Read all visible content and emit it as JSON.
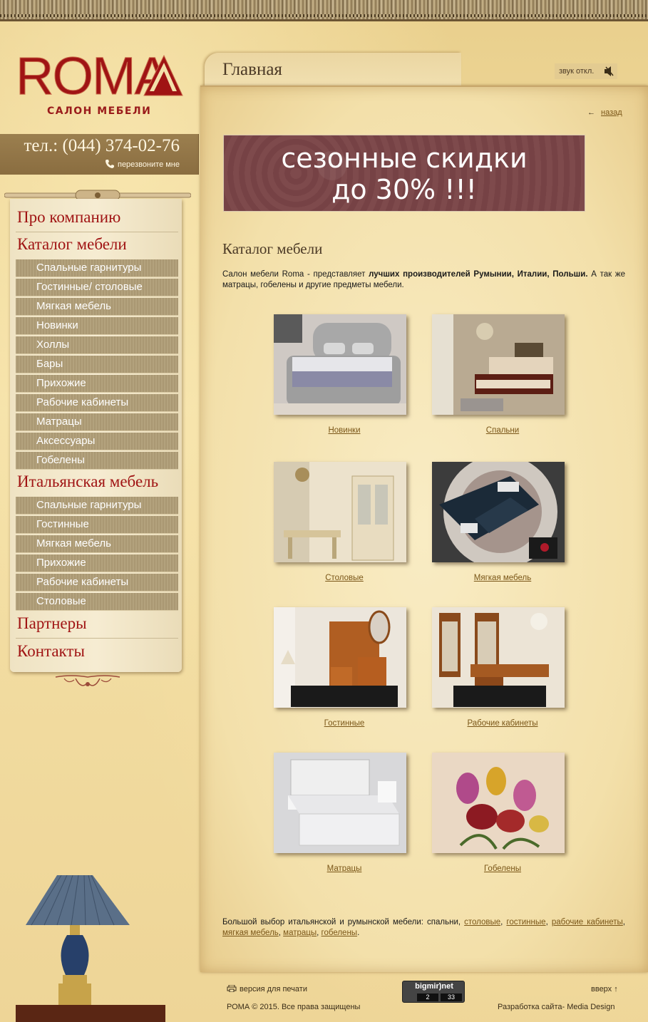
{
  "logo": {
    "name": "ROMA",
    "subtitle": "САЛОН МЕБЕЛИ"
  },
  "contact": {
    "phone": "тел.: (044) 374-02-76",
    "callback": "перезвоните мне"
  },
  "menu": {
    "about": "Про компанию",
    "catalog": "Каталог мебели",
    "catalog_items": [
      "Спальные гарнитуры",
      "Гостинные/ столовые",
      "Мягкая мебель",
      "Новинки",
      "Холлы",
      "Бары",
      "Прихожие",
      "Рабочие кабинеты",
      "Матрацы",
      "Аксессуары",
      "Гобелены"
    ],
    "italian": "Итальянская мебель",
    "italian_items": [
      "Спальные гарнитуры",
      "Гостинные",
      "Мягкая мебель",
      "Прихожие",
      "Рабочие кабинеты",
      "Столовые"
    ],
    "partners": "Партнеры",
    "contacts": "Контакты"
  },
  "header": {
    "title": "Главная",
    "sound": "звук откл."
  },
  "nav": {
    "back": "назад"
  },
  "banner": {
    "line1": "сезонные скидки",
    "line2": "до 30% !!!"
  },
  "main": {
    "section_title": "Каталог мебели",
    "intro_plain": "Салон мебели Roma - представляет ",
    "intro_bold": " лучших производителей Румынии, Италии, Польши.",
    "intro_tail": " А так же матрацы, гобелены и другие предметы мебели.",
    "tiles": [
      "Новинки",
      "Спальни",
      "Столовые",
      "Мягкая мебель",
      "Гостинные",
      "Рабочие кабинеты",
      "Матрацы",
      "Гобелены"
    ],
    "bottom_lead": "Большой выбор итальянской и румынской мебели: спальни, ",
    "bottom_links": [
      "столовые",
      "гостинные",
      "рабочие кабинеты",
      "мягкая мебель",
      "матрацы",
      "гобелены"
    ]
  },
  "footer": {
    "print": "версия для печати",
    "copyright": "РОМА © 2015. Все права защищены",
    "up": "вверх",
    "developer": "Разработка сайта- Media Design",
    "counter_brand": "bigmir)net",
    "counter_a": "2",
    "counter_b": "33"
  },
  "colors": {
    "menu_red": "#a01414",
    "submenu_bg": "#b3a27d",
    "banner_bg": "#7e4a4c",
    "link": "#7a5618"
  }
}
